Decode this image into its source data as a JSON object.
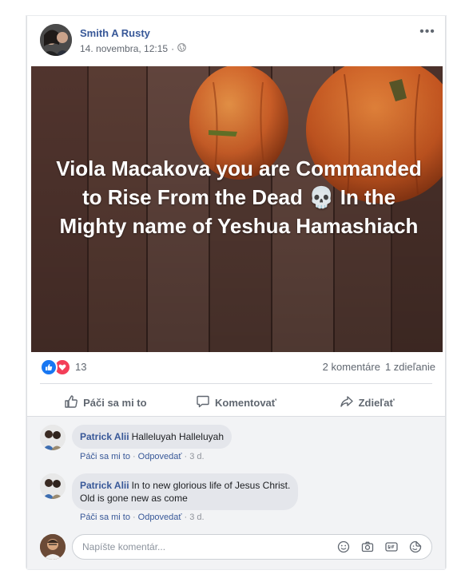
{
  "post": {
    "author": "Smith A Rusty",
    "timestamp": "14. novembra, 12:15",
    "privacy_icon": "globe-icon",
    "more_icon": "more-options-icon",
    "more_label": "•••",
    "text_before": "Viola Macakova you are Commanded to Rise From the Dead",
    "emoji": "💀",
    "text_after": "In the Mighty name of Yeshua Hamashiach",
    "background": "pumpkins-on-wood"
  },
  "reactions": {
    "count": "13",
    "comments_label": "2 komentáre",
    "shares_label": "1 zdieľanie"
  },
  "actions": [
    {
      "label": "Páči sa mi to",
      "icon": "like-icon"
    },
    {
      "label": "Komentovať",
      "icon": "comment-icon"
    },
    {
      "label": "Zdieľať",
      "icon": "share-icon"
    }
  ],
  "comments": [
    {
      "author": "Patrick Alii",
      "text_line1": "Halleluyah Halleluyah",
      "text_line2": "",
      "like": "Páči sa mi to",
      "reply": "Odpovedať",
      "time": "3 d."
    },
    {
      "author": "Patrick Alii",
      "text_line1": "In to new glorious life of Jesus Christ.",
      "text_line2": "Old is gone new as come",
      "like": "Páči sa mi to",
      "reply": "Odpovedať",
      "time": "3 d."
    }
  ],
  "reply_box": {
    "placeholder": "Napíšte komentár...",
    "tools": [
      "emoji-icon",
      "camera-icon",
      "gif-icon",
      "sticker-icon"
    ]
  },
  "colors": {
    "link": "#385898",
    "like": "#1877f2",
    "love": "#f33e58"
  }
}
